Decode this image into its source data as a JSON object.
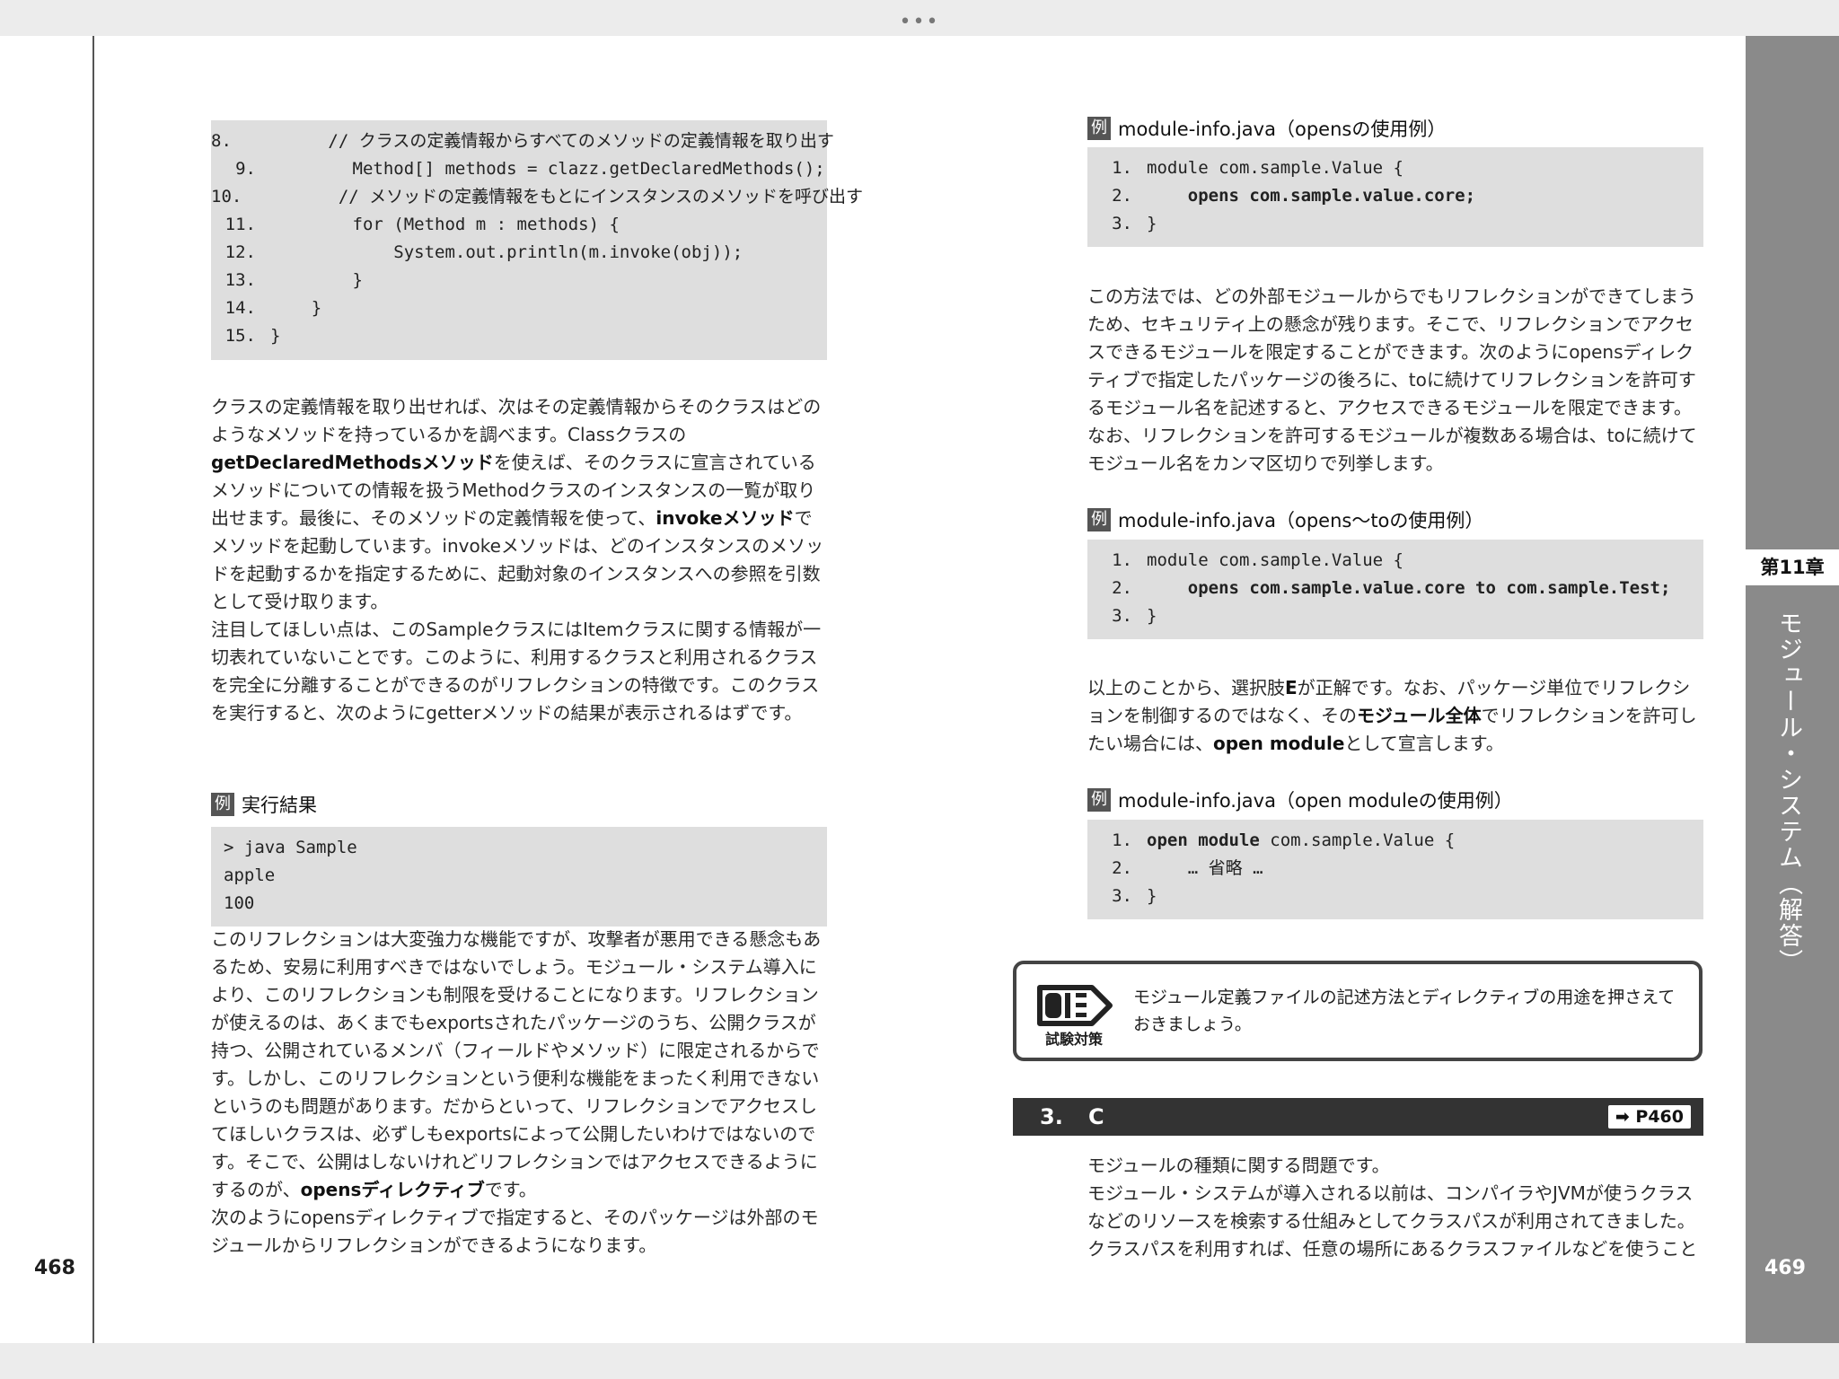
{
  "window": {
    "menu_dots": "•••"
  },
  "left_page": {
    "code_block_1": [
      {
        "num": "8.",
        "text": "        // クラスの定義情報からすべてのメソッドの定義情報を取り出す"
      },
      {
        "num": "9.",
        "text": "        Method[] methods = clazz.getDeclaredMethods();"
      },
      {
        "num": "10.",
        "text": "        // メソッドの定義情報をもとにインスタンスのメソッドを呼び出す"
      },
      {
        "num": "11.",
        "text": "        for (Method m : methods) {"
      },
      {
        "num": "12.",
        "text": "            System.out.println(m.invoke(obj));"
      },
      {
        "num": "13.",
        "text": "        }"
      },
      {
        "num": "14.",
        "text": "    }"
      },
      {
        "num": "15.",
        "text": "}"
      }
    ],
    "para_1": {
      "a": "クラスの定義情報を取り出せれば、次はその定義情報からそのクラスはどのようなメソッドを持っているかを調べます。Classクラスの",
      "b": "getDeclaredMethodsメソッド",
      "c": "を使えば、そのクラスに宣言されているメソッドについての情報を扱うMethodクラスのインスタンスの一覧が取り出せます。最後に、そのメソッドの定義情報を使って、",
      "d": "invokeメソッド",
      "e": "でメソッドを起動しています。invokeメソッドは、どのインスタンスのメソッドを起動するかを指定するために、起動対象のインスタンスへの参照を引数として受け取ります。",
      "f": "注目してほしい点は、このSampleクラスにはItemクラスに関する情報が一切表れていないことです。このように、利用するクラスと利用されるクラスを完全に分離することができるのがリフレクションの特徴です。このクラスを実行すると、次のようにgetterメソッドの結果が表示されるはずです。"
    },
    "example_1": {
      "tag": "例",
      "label": "実行結果"
    },
    "code_block_2": [
      "> java Sample",
      "apple",
      "100"
    ],
    "para_2": {
      "a": "このリフレクションは大変強力な機能ですが、攻撃者が悪用できる懸念もあるため、安易に利用すべきではないでしょう。モジュール・システム導入により、このリフレクションも制限を受けることになります。リフレクションが使えるのは、あくまでもexportsされたパッケージのうち、公開クラスが持つ、公開されているメンバ（フィールドやメソッド）に限定されるからです。しかし、このリフレクションという便利な機能をまったく利用できないというのも問題があります。だからといって、リフレクションでアクセスしてほしいクラスは、必ずしもexportsによって公開したいわけではないのです。そこで、公開はしないけれどリフレクションではアクセスできるようにするのが、",
      "b": "opensディレクティブ",
      "c": "です。",
      "d": "次のようにopensディレクティブで指定すると、そのパッケージは外部のモジュールからリフレクションができるようになります。"
    },
    "page_number": "468"
  },
  "right_page": {
    "example_2": {
      "tag": "例",
      "label": "module-info.java（opensの使用例）"
    },
    "code_block_3": [
      {
        "num": "1.",
        "pre": "module com.sample.Value {",
        "bold": "",
        "post": ""
      },
      {
        "num": "2.",
        "pre": "    ",
        "bold": "opens com.sample.value.core;",
        "post": ""
      },
      {
        "num": "3.",
        "pre": "}",
        "bold": "",
        "post": ""
      }
    ],
    "para_3": "この方法では、どの外部モジュールからでもリフレクションができてしまうため、セキュリティ上の懸念が残ります。そこで、リフレクションでアクセスできるモジュールを限定することができます。次のようにopensディレクティブで指定したパッケージの後ろに、toに続けてリフレクションを許可するモジュール名を記述すると、アクセスできるモジュールを限定できます。なお、リフレクションを許可するモジュールが複数ある場合は、toに続けてモジュール名をカンマ区切りで列挙します。",
    "example_3": {
      "tag": "例",
      "label": "module-info.java（opens～toの使用例）"
    },
    "code_block_4": [
      {
        "num": "1.",
        "pre": "module com.sample.Value {",
        "bold": "",
        "post": ""
      },
      {
        "num": "2.",
        "pre": "    ",
        "bold": "opens com.sample.value.core to com.sample.Test;",
        "post": ""
      },
      {
        "num": "3.",
        "pre": "}",
        "bold": "",
        "post": ""
      }
    ],
    "para_4": {
      "a": "以上のことから、選択肢",
      "b": "E",
      "c": "が正解です。なお、パッケージ単位でリフレクションを制御するのではなく、その",
      "d": "モジュール全体",
      "e": "でリフレクションを許可したい場合には、",
      "f": "open module",
      "g": "として宣言します。"
    },
    "example_4": {
      "tag": "例",
      "label": "module-info.java（open moduleの使用例）"
    },
    "code_block_5": [
      {
        "num": "1.",
        "pre": "",
        "bold": "open module",
        "post": " com.sample.Value {"
      },
      {
        "num": "2.",
        "pre": "    … 省略 …",
        "bold": "",
        "post": ""
      },
      {
        "num": "3.",
        "pre": "}",
        "bold": "",
        "post": ""
      }
    ],
    "tip": {
      "icon_label": "試験対策",
      "text": "モジュール定義ファイルの記述方法とディレクティブの用途を押さえておきましょう。"
    },
    "section": {
      "number": "3.",
      "answer": "C",
      "ref": "➡ P460"
    },
    "para_5": [
      "モジュールの種類に関する問題です。",
      "モジュール・システムが導入される以前は、コンパイラやJVMが使うクラスなどのリソースを検索する仕組みとしてクラスパスが利用されてきました。クラスパスを利用すれば、任意の場所にあるクラスファイルなどを使うこと"
    ],
    "page_number": "469",
    "side_tab": {
      "chapter": "第11章",
      "title": "モジュール・システム（解答）"
    }
  }
}
